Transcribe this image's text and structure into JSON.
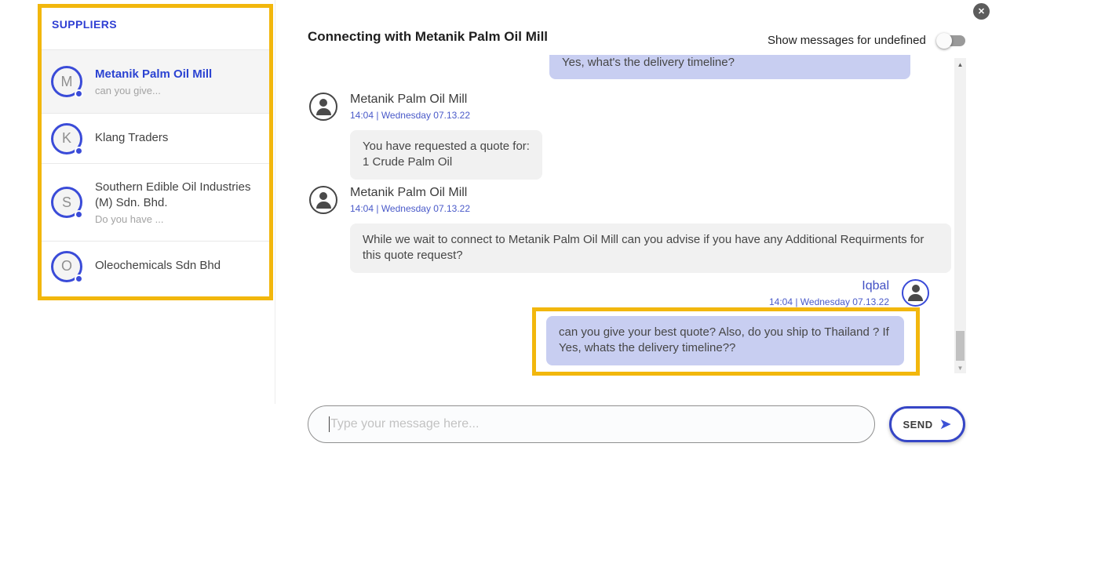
{
  "sidebar": {
    "title": "SUPPLIERS",
    "items": [
      {
        "initial": "M",
        "name": "Metanik Palm Oil Mill",
        "preview": "can you give...",
        "selected": true
      },
      {
        "initial": "K",
        "name": "Klang Traders",
        "preview": "",
        "selected": false
      },
      {
        "initial": "S",
        "name": "Southern Edible Oil Industries (M) Sdn. Bhd.",
        "preview": "Do you have ...",
        "selected": false
      },
      {
        "initial": "O",
        "name": "Oleochemicals Sdn Bhd",
        "preview": "",
        "selected": false
      }
    ]
  },
  "header": {
    "title": "Connecting with Metanik Palm Oil Mill",
    "toggle_label": "Show messages for undefined",
    "toggle_state": "off"
  },
  "chat": {
    "messages": [
      {
        "direction": "outgoing",
        "partial": true,
        "text": "Yes, what's the delivery timeline?"
      },
      {
        "direction": "incoming",
        "sender": "Metanik Palm Oil Mill",
        "timestamp": "14:04 | Wednesday 07.13.22",
        "text": "You have requested a quote for:\n1 Crude Palm Oil"
      },
      {
        "direction": "incoming",
        "sender": "Metanik Palm Oil Mill",
        "timestamp": "14:04 | Wednesday 07.13.22",
        "text": "While we wait to connect to Metanik Palm Oil Mill can you advise if you have any Additional Requirments for this quote request?"
      },
      {
        "direction": "outgoing",
        "sender": "Iqbal",
        "timestamp": "14:04 | Wednesday 07.13.22",
        "highlighted": true,
        "text": "can you give your best quote? Also, do you ship to Thailand ? If Yes, whats the delivery timeline??"
      }
    ]
  },
  "composer": {
    "placeholder": "Type your message here...",
    "send_label": "SEND"
  },
  "icons": {
    "close": "✕",
    "send": "➤",
    "scroll_up": "▲",
    "scroll_down": "▼"
  },
  "colors": {
    "highlight_gold": "#F2B70D",
    "accent_blue": "#3A4BD8",
    "timestamp_blue": "#4A5AC9",
    "outgoing_bubble": "#C8CEF1",
    "incoming_bubble": "#F1F1F1"
  }
}
